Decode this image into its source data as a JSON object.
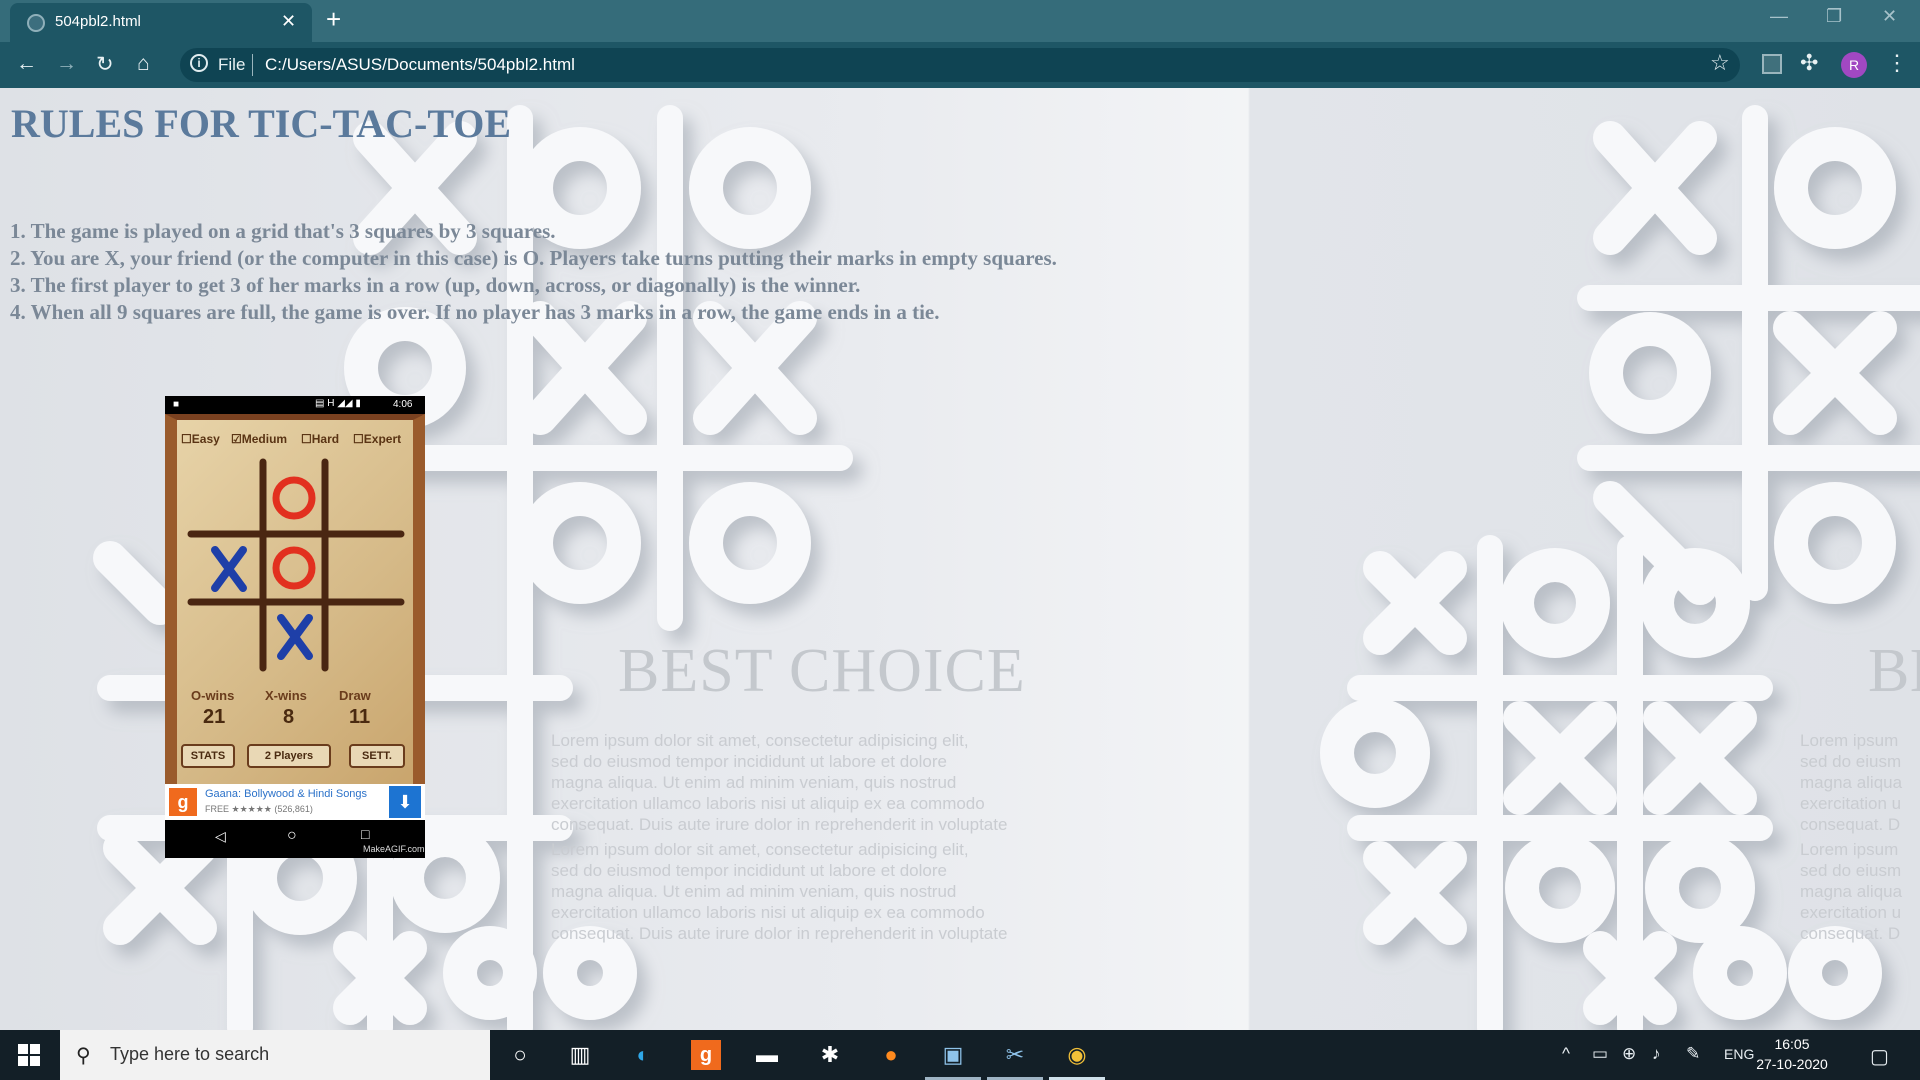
{
  "browser": {
    "tab_title": "504pbl2.html",
    "tab_close": "✕",
    "new_tab": "+",
    "address_scheme": "File",
    "address_url": "C:/Users/ASUS/Documents/504pbl2.html",
    "profile_initial": "R"
  },
  "page": {
    "title": "RULES FOR TIC-TAC-TOE",
    "rules": [
      "1. The game is played on a grid that's 3 squares by 3 squares.",
      "2. You are X, your friend (or the computer in this case) is O. Players take turns putting their marks in empty squares.",
      "3. The first player to get 3 of her marks in a row (up, down, across, or diagonally) is the winner.",
      "4. When all 9 squares are full, the game is over. If no player has 3 marks in a row, the game ends in a tie."
    ],
    "background_heading": "BEST CHOICE",
    "background_heading_right": "BI",
    "lorem_lines": [
      "Lorem ipsum dolor sit amet, consectetur adipisicing elit,",
      "sed do eiusmod tempor incididunt ut labore et dolore",
      "magna aliqua. Ut enim ad minim veniam, quis nostrud",
      "exercitation ullamco laboris nisi ut aliquip ex ea commodo",
      "consequat. Duis aute irure dolor in reprehenderit in voluptate"
    ],
    "lorem_right_lines": [
      "Lorem ipsum",
      "sed do eiusm",
      "magna aliqua",
      "exercitation u",
      "consequat. D"
    ]
  },
  "phone_gif": {
    "status_time": "4:06",
    "difficulty": [
      "Easy",
      "Medium",
      "Hard",
      "Expert"
    ],
    "difficulty_checked": "Medium",
    "board": [
      "",
      "O",
      "",
      "X",
      "O",
      "",
      "",
      "X",
      ""
    ],
    "stats_labels": [
      "O-wins",
      "X-wins",
      "Draw"
    ],
    "stats_values": [
      "21",
      "8",
      "11"
    ],
    "buttons": [
      "STATS",
      "2 Players",
      "SETT."
    ],
    "ad_logo": "g",
    "ad_title": "Gaana: Bollywood & Hindi Songs",
    "ad_sub": "FREE ★★★★★ (526,861)",
    "watermark": "MakeAGIF.com"
  },
  "taskbar": {
    "search_placeholder": "Type here to search",
    "language": "ENG",
    "time": "16:05",
    "date": "27-10-2020"
  },
  "colors": {
    "chrome_accent": "#1e5665",
    "title_color": "#5b7a9c",
    "avatar": "#a148c2"
  }
}
